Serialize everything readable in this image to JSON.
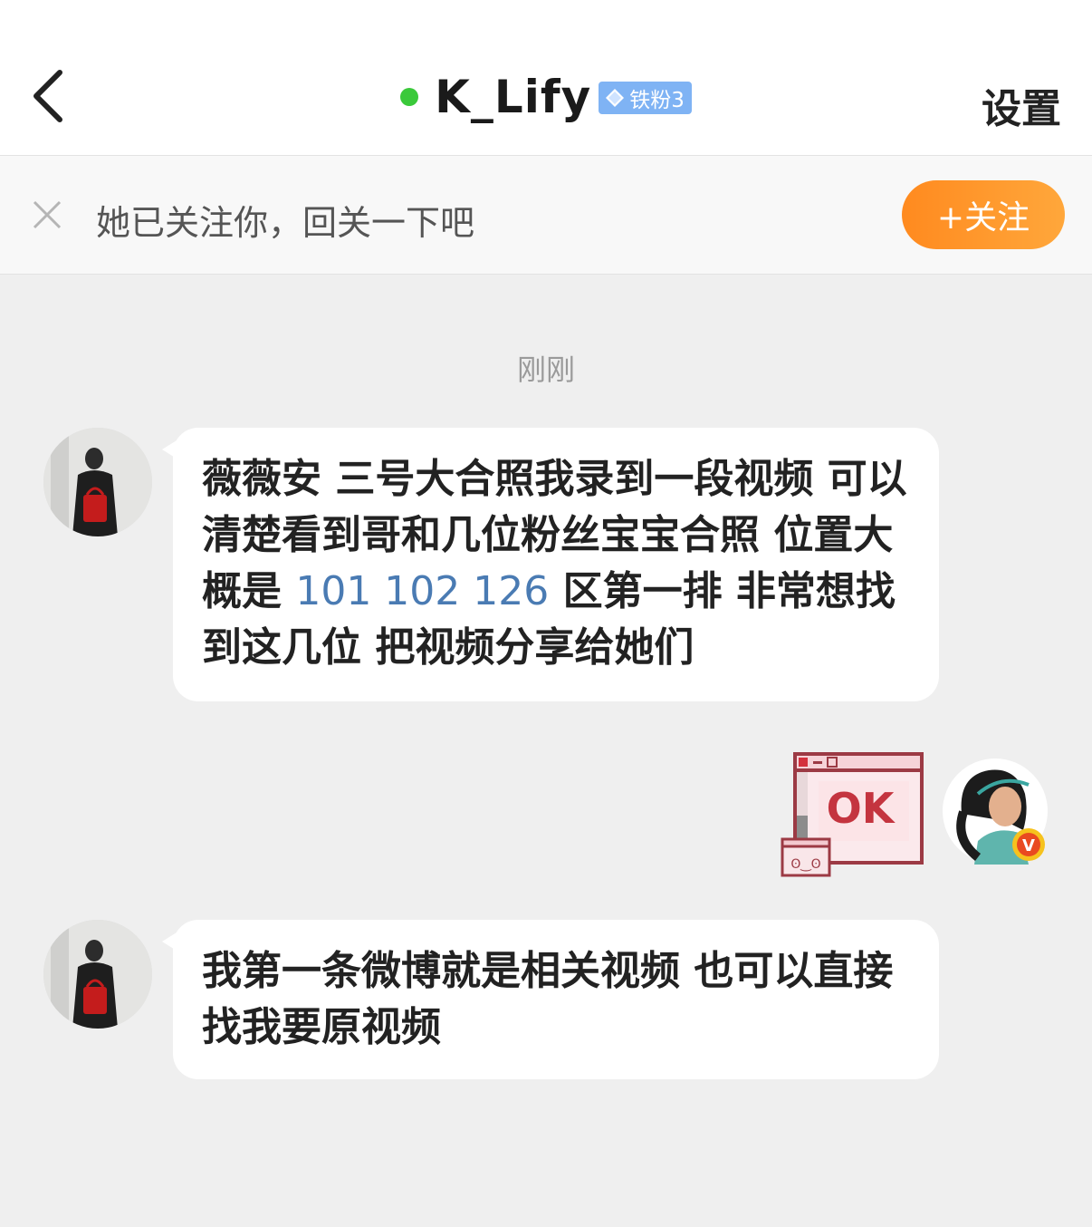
{
  "header": {
    "back_icon": "chevron-left-icon",
    "online_color": "#3ac93a",
    "title": "K_Lify",
    "badge_icon": "diamond-icon",
    "badge_text": "铁粉3",
    "settings_label": "设置"
  },
  "follow_prompt": {
    "close_icon": "close-icon",
    "text": "她已关注你，回关一下吧",
    "button_label": "+关注",
    "button_color": "#ff9326"
  },
  "timestamp": "刚刚",
  "messages": [
    {
      "sender": "other",
      "avatar_icon": "avatar",
      "text_part1": "薇薇安 三号大合照我录到一段视频 可以清楚看到哥和几位粉丝宝宝合照 位置大概是 ",
      "link": "101 102 126",
      "text_part2": " 区第一排 非常想找到这几位 把视频分享给她们"
    },
    {
      "sender": "me",
      "sticker_text": "OK",
      "sticker_face": "ʘ‿ʘ",
      "verified_badge": "V"
    },
    {
      "sender": "other",
      "avatar_icon": "avatar",
      "text": "我第一条微博就是相关视频 也可以直接找我要原视频"
    }
  ]
}
